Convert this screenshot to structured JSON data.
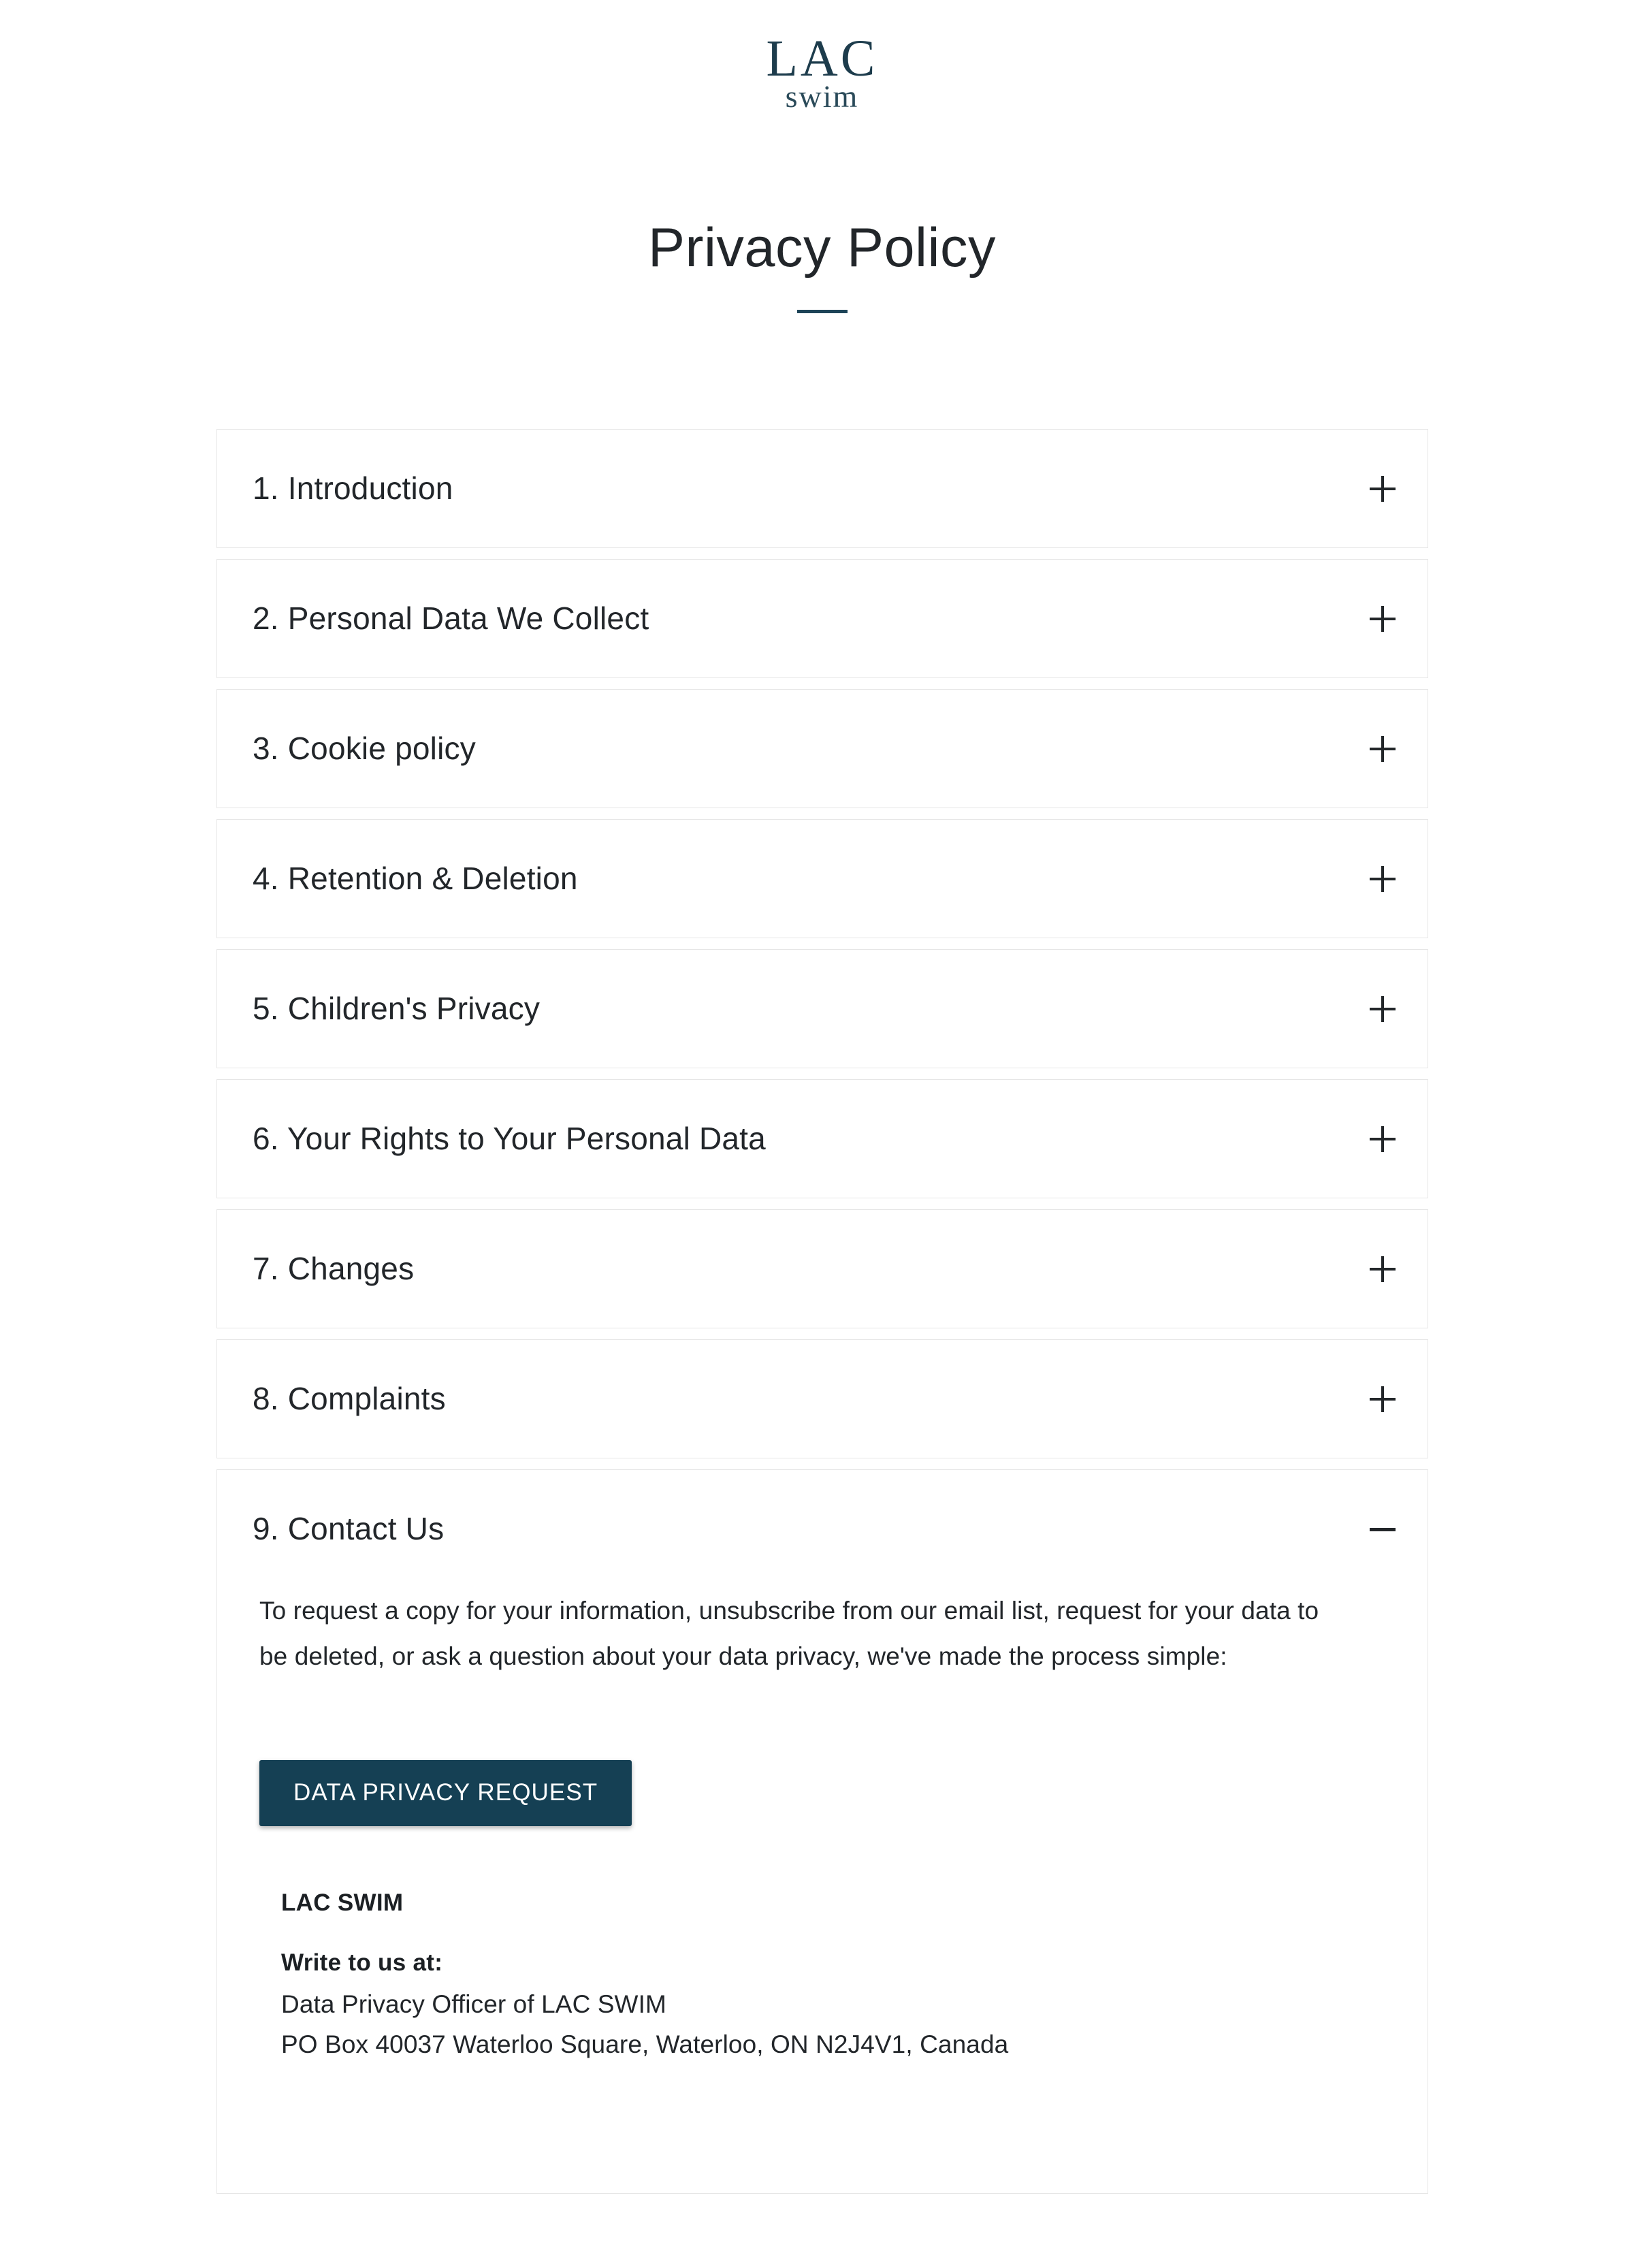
{
  "brand": {
    "logo_main": "LAC",
    "logo_sub": "swim",
    "accent_color": "#1d4458",
    "button_color": "#154054"
  },
  "header": {
    "title": "Privacy Policy"
  },
  "accordion": {
    "items": [
      {
        "label": "1. Introduction",
        "icon": "plus-icon",
        "expanded": false
      },
      {
        "label": "2. Personal Data We Collect",
        "icon": "plus-icon",
        "expanded": false
      },
      {
        "label": "3. Cookie policy",
        "icon": "plus-icon",
        "expanded": false
      },
      {
        "label": "4. Retention & Deletion",
        "icon": "plus-icon",
        "expanded": false
      },
      {
        "label": "5. Children's Privacy",
        "icon": "plus-icon",
        "expanded": false
      },
      {
        "label": "6. Your Rights to Your Personal Data",
        "icon": "plus-icon",
        "expanded": false
      },
      {
        "label": "7. Changes",
        "icon": "plus-icon",
        "expanded": false
      },
      {
        "label": "8. Complaints",
        "icon": "plus-icon",
        "expanded": false
      },
      {
        "label": "9. Contact Us",
        "icon": "minus-icon",
        "expanded": true
      }
    ]
  },
  "contact_panel": {
    "intro": "To request a copy for your information, unsubscribe from our email list, request for your data to be deleted, or ask a question about your data privacy, we've made the process simple:",
    "cta_label": "DATA PRIVACY REQUEST",
    "company": "LAC SWIM",
    "write_to_label": "Write to us at:",
    "address_line_1": "Data Privacy Officer of LAC SWIM",
    "address_line_2": "PO Box 40037 Waterloo Square, Waterloo, ON N2J4V1, Canada"
  }
}
